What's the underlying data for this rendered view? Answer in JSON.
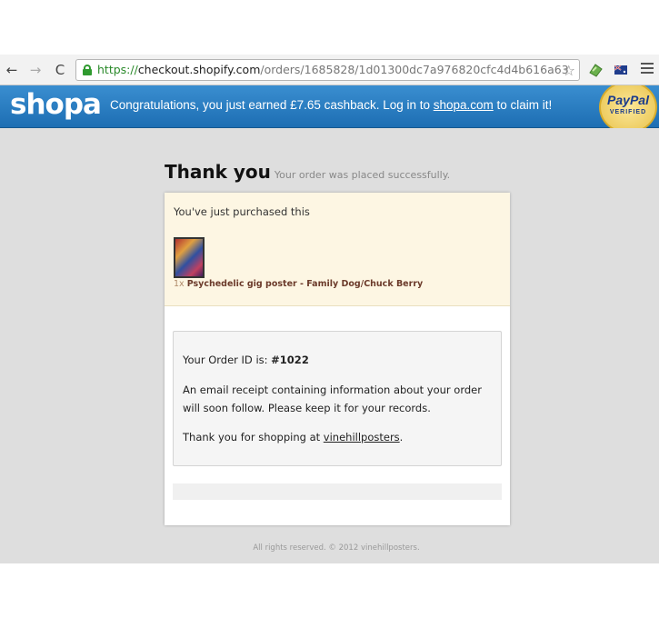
{
  "browser": {
    "url_scheme": "https://",
    "url_host": "checkout.shopify.com",
    "url_path": "/orders/1685828/1d01300dc7a976820cfc4d4b616a63",
    "back_glyph": "←",
    "forward_glyph": "→",
    "reload_glyph": "C",
    "star_glyph": "☆"
  },
  "shopa": {
    "logo": "shopa",
    "message_prefix": "Congratulations, you just earned £7.65 cashback. Log in to ",
    "message_link": "shopa.com",
    "message_suffix": " to claim it!",
    "paypal_label": "PayPal",
    "paypal_sub": "VERIFIED"
  },
  "page": {
    "title": "Thank you",
    "subtitle": "Your order was placed successfully.",
    "purchased_label": "You've just purchased this",
    "product_qty": "1x",
    "product_name": "Psychedelic gig poster - Family Dog/Chuck Berry",
    "order_id_prefix": "Your Order ID is: ",
    "order_id": "#1022",
    "email_notice": "An email receipt containing information about your order will soon follow. Please keep it for your records.",
    "thanks_prefix": "Thank you for shopping at ",
    "store_link": "vinehillposters",
    "thanks_suffix": ".",
    "footer": "All rights reserved. © 2012 vinehillposters."
  },
  "colors": {
    "banner_blue": "#1d6eb3",
    "page_bg": "#dedede",
    "purchased_bg": "#fdf6e3",
    "product_name": "#6b3a2a",
    "url_green": "#2a8a2a"
  }
}
